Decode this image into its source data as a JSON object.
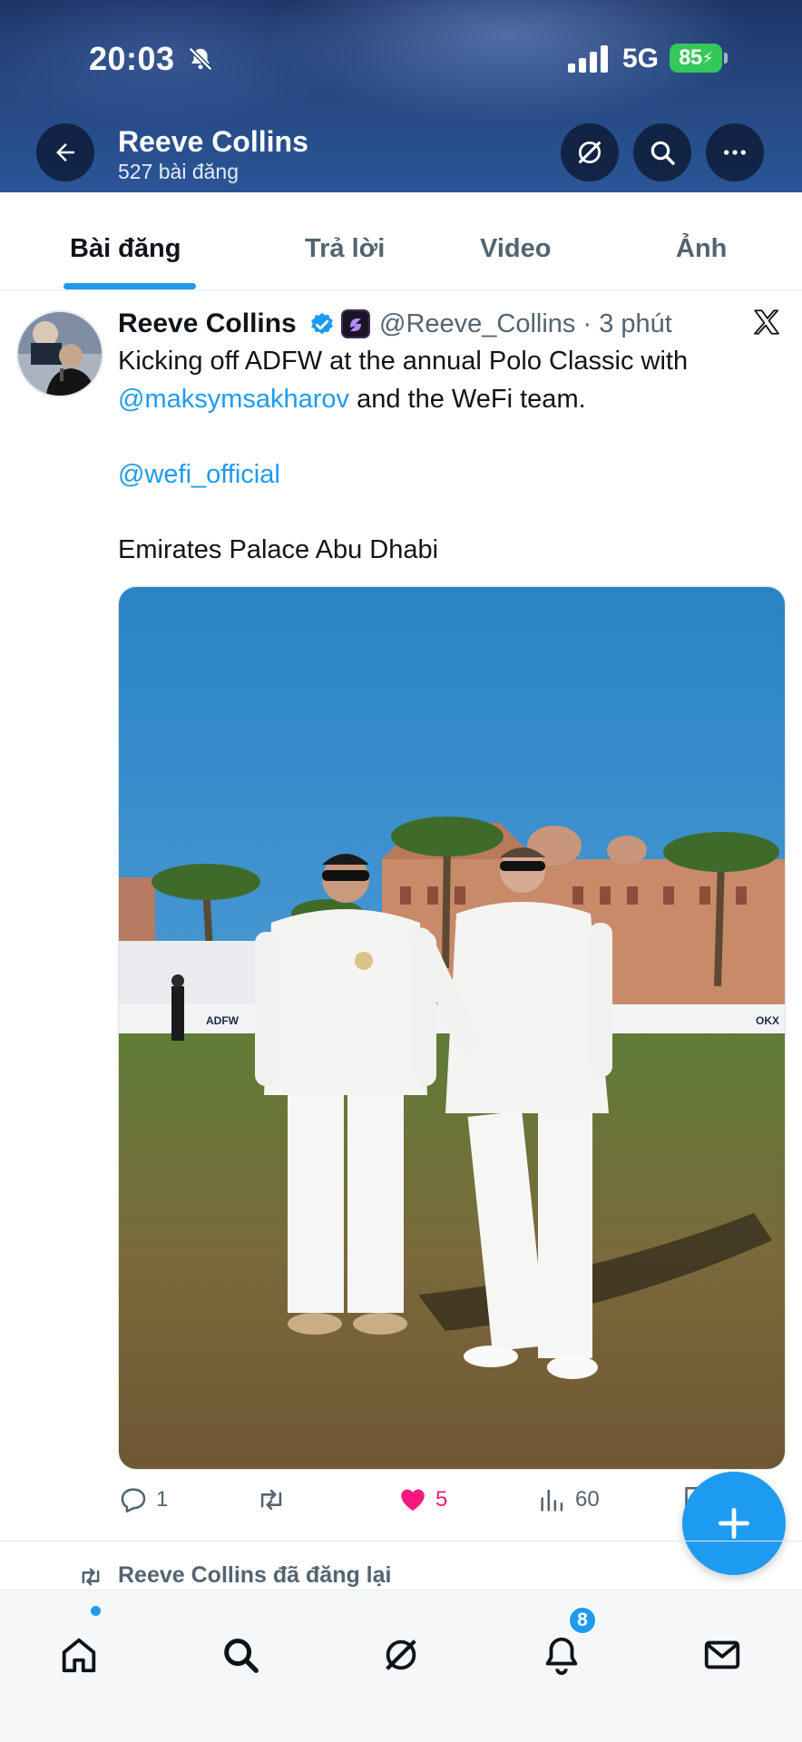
{
  "status_bar": {
    "time": "20:03",
    "network": "5G",
    "battery": "85"
  },
  "profile_header": {
    "name": "Reeve Collins",
    "post_count": "527 bài đăng"
  },
  "tabs": [
    {
      "label": "Bài đăng",
      "active": true
    },
    {
      "label": "Trả lời",
      "active": false
    },
    {
      "label": "Video",
      "active": false
    },
    {
      "label": "Ảnh",
      "active": false
    }
  ],
  "tweet": {
    "author_name": "Reeve Collins",
    "handle_time": "@Reeve_Collins · 3 phút",
    "line1": "Kicking off ADFW at the annual Polo Classic with",
    "mention1": "@maksymsakharov",
    "line2_rest": " and the WeFi team.",
    "mention2": "@wefi_official",
    "location_line": "Emirates Palace Abu Dhabi",
    "media_banner_texts": [
      "ADFW",
      "OKX"
    ],
    "stats": {
      "replies": "1",
      "likes": "5",
      "views": "60"
    },
    "liked": true
  },
  "repost_note": "Reeve Collins đã đăng lại",
  "bottom_nav": {
    "notifications_badge": "8"
  },
  "colors": {
    "accent": "#1d9bf0",
    "like": "#f91880",
    "muted": "#536471"
  }
}
